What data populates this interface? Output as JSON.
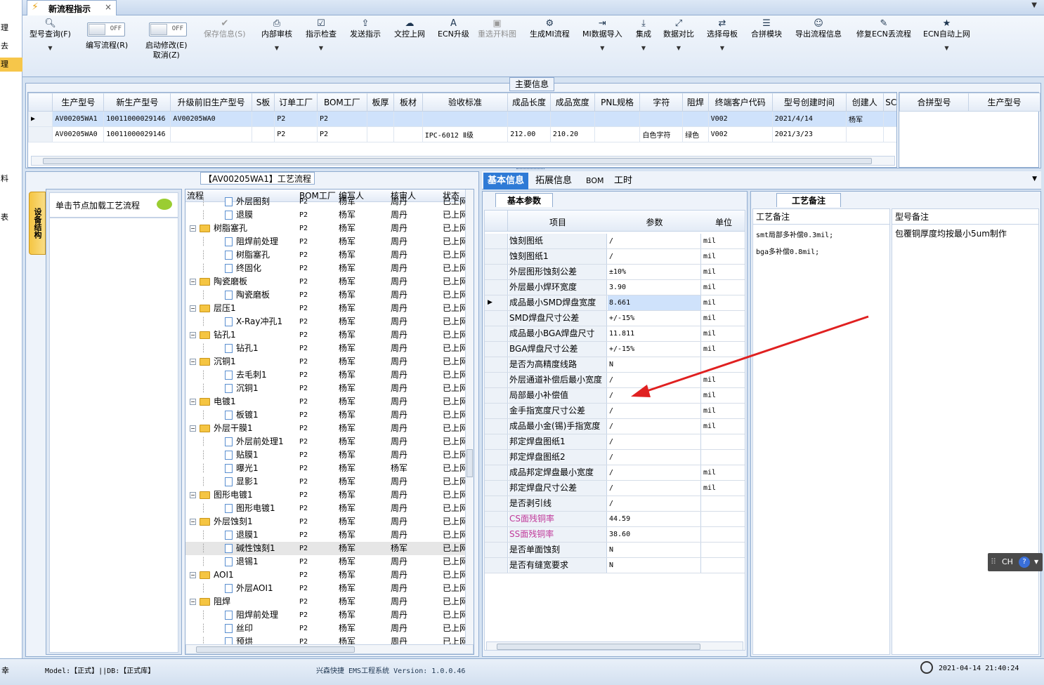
{
  "left_nav": {
    "items": [
      "理",
      "去",
      "理",
      "",
      "",
      "",
      "",
      "",
      "料",
      "",
      "表"
    ]
  },
  "tab": {
    "title": "新流程指示"
  },
  "toolbar": {
    "model_query": "型号查询(F)",
    "edit_flow_toggle": "OFF",
    "edit_flow": "编写流程(R)",
    "enable_modify_toggle": "OFF",
    "enable_modify_1": "启动修改(E)",
    "enable_modify_2": "取消(Z)",
    "save_info": "保存信息(S)",
    "internal_review": "内部审核",
    "instruction_check": "指示检查",
    "send_instruction": "发送指示",
    "doc_control_upload": "文控上网",
    "ecn_upgrade": "ECN升级",
    "reselect_chart": "重选开料图",
    "gen_mi_flow": "生成MI流程",
    "mi_data_import": "MI数据导入",
    "integrate": "集成",
    "data_compare": "数据对比",
    "select_parent": "选择母板",
    "merge_module": "合拼模块",
    "export_flow_info": "导出流程信息",
    "repair_ecn_lost": "修复ECN丢流程",
    "ecn_auto_upload": "ECN自动上网"
  },
  "main_info": {
    "title": "主要信息",
    "columns": [
      "生产型号",
      "新生产型号",
      "升级前旧生产型号",
      "S板",
      "订单工厂",
      "BOM工厂",
      "板厚",
      "板材",
      "验收标准",
      "成品长度",
      "成品宽度",
      "PNL规格",
      "字符",
      "阻焊",
      "终端客户代码",
      "型号创建时间",
      "创建人",
      "SC"
    ],
    "rows": [
      [
        "AV00205WA1",
        "10011000029146",
        "AV00205WA0",
        "",
        "P2",
        "P2",
        "",
        "",
        "",
        "",
        "",
        "",
        "",
        "",
        "V002",
        "2021/4/14",
        "杨军",
        ""
      ],
      [
        "AV00205WA0",
        "10011000029146",
        "",
        "",
        "P2",
        "P2",
        "",
        "",
        "IPC-6012 Ⅱ级",
        "212.00",
        "210.20",
        "",
        "白色字符",
        "绿色",
        "V002",
        "2021/3/23",
        "",
        ""
      ]
    ]
  },
  "merge_panel": {
    "columns": [
      "合拼型号",
      "生产型号"
    ]
  },
  "process_flow": {
    "title": "【AV00205WA1】工艺流程",
    "side_tab": "设备结构",
    "hint": "单击节点加载工艺流程",
    "columns": [
      "流程",
      "BOM工厂",
      "编写人",
      "核审人",
      "状态"
    ],
    "rows": [
      {
        "lvl": 1,
        "name": "外层图刻",
        "bom": "P2",
        "w": "杨军",
        "r": "周丹",
        "s": "已上网"
      },
      {
        "lvl": 1,
        "name": "退膜",
        "bom": "P2",
        "w": "杨军",
        "r": "周丹",
        "s": "已上网"
      },
      {
        "lvl": 0,
        "name": "树脂塞孔",
        "bom": "P2",
        "w": "杨军",
        "r": "周丹",
        "s": "已上网"
      },
      {
        "lvl": 1,
        "name": "阻焊前处理",
        "bom": "P2",
        "w": "杨军",
        "r": "周丹",
        "s": "已上网"
      },
      {
        "lvl": 1,
        "name": "树脂塞孔",
        "bom": "P2",
        "w": "杨军",
        "r": "周丹",
        "s": "已上网"
      },
      {
        "lvl": 1,
        "name": "终固化",
        "bom": "P2",
        "w": "杨军",
        "r": "周丹",
        "s": "已上网"
      },
      {
        "lvl": 0,
        "name": "陶瓷磨板",
        "bom": "P2",
        "w": "杨军",
        "r": "周丹",
        "s": "已上网"
      },
      {
        "lvl": 1,
        "name": "陶瓷磨板",
        "bom": "P2",
        "w": "杨军",
        "r": "周丹",
        "s": "已上网"
      },
      {
        "lvl": 0,
        "name": "层压1",
        "bom": "P2",
        "w": "杨军",
        "r": "周丹",
        "s": "已上网"
      },
      {
        "lvl": 1,
        "name": "X-Ray冲孔1",
        "bom": "P2",
        "w": "杨军",
        "r": "周丹",
        "s": "已上网"
      },
      {
        "lvl": 0,
        "name": "钻孔1",
        "bom": "P2",
        "w": "杨军",
        "r": "周丹",
        "s": "已上网"
      },
      {
        "lvl": 1,
        "name": "钻孔1",
        "bom": "P2",
        "w": "杨军",
        "r": "周丹",
        "s": "已上网"
      },
      {
        "lvl": 0,
        "name": "沉铜1",
        "bom": "P2",
        "w": "杨军",
        "r": "周丹",
        "s": "已上网"
      },
      {
        "lvl": 1,
        "name": "去毛刺1",
        "bom": "P2",
        "w": "杨军",
        "r": "周丹",
        "s": "已上网"
      },
      {
        "lvl": 1,
        "name": "沉铜1",
        "bom": "P2",
        "w": "杨军",
        "r": "周丹",
        "s": "已上网"
      },
      {
        "lvl": 0,
        "name": "电镀1",
        "bom": "P2",
        "w": "杨军",
        "r": "周丹",
        "s": "已上网"
      },
      {
        "lvl": 1,
        "name": "板镀1",
        "bom": "P2",
        "w": "杨军",
        "r": "周丹",
        "s": "已上网"
      },
      {
        "lvl": 0,
        "name": "外层干膜1",
        "bom": "P2",
        "w": "杨军",
        "r": "周丹",
        "s": "已上网"
      },
      {
        "lvl": 1,
        "name": "外层前处理1",
        "bom": "P2",
        "w": "杨军",
        "r": "周丹",
        "s": "已上网"
      },
      {
        "lvl": 1,
        "name": "贴膜1",
        "bom": "P2",
        "w": "杨军",
        "r": "周丹",
        "s": "已上网"
      },
      {
        "lvl": 1,
        "name": "曝光1",
        "bom": "P2",
        "w": "杨军",
        "r": "杨军",
        "s": "已上网"
      },
      {
        "lvl": 1,
        "name": "显影1",
        "bom": "P2",
        "w": "杨军",
        "r": "周丹",
        "s": "已上网"
      },
      {
        "lvl": 0,
        "name": "图形电镀1",
        "bom": "P2",
        "w": "杨军",
        "r": "周丹",
        "s": "已上网"
      },
      {
        "lvl": 1,
        "name": "图形电镀1",
        "bom": "P2",
        "w": "杨军",
        "r": "周丹",
        "s": "已上网"
      },
      {
        "lvl": 0,
        "name": "外层蚀刻1",
        "bom": "P2",
        "w": "杨军",
        "r": "周丹",
        "s": "已上网"
      },
      {
        "lvl": 1,
        "name": "退膜1",
        "bom": "P2",
        "w": "杨军",
        "r": "周丹",
        "s": "已上网"
      },
      {
        "lvl": 1,
        "name": "碱性蚀刻1",
        "bom": "P2",
        "w": "杨军",
        "r": "杨军",
        "s": "已上网",
        "sel": true
      },
      {
        "lvl": 1,
        "name": "退锡1",
        "bom": "P2",
        "w": "杨军",
        "r": "周丹",
        "s": "已上网"
      },
      {
        "lvl": 0,
        "name": "AOI1",
        "bom": "P2",
        "w": "杨军",
        "r": "周丹",
        "s": "已上网"
      },
      {
        "lvl": 1,
        "name": "外层AOI1",
        "bom": "P2",
        "w": "杨军",
        "r": "周丹",
        "s": "已上网"
      },
      {
        "lvl": 0,
        "name": "阻焊",
        "bom": "P2",
        "w": "杨军",
        "r": "周丹",
        "s": "已上网"
      },
      {
        "lvl": 1,
        "name": "阻焊前处理",
        "bom": "P2",
        "w": "杨军",
        "r": "周丹",
        "s": "已上网"
      },
      {
        "lvl": 1,
        "name": "丝印",
        "bom": "P2",
        "w": "杨军",
        "r": "周丹",
        "s": "已上网"
      },
      {
        "lvl": 1,
        "name": "预烘",
        "bom": "P2",
        "w": "杨军",
        "r": "周丹",
        "s": "已上网"
      }
    ]
  },
  "detail_tabs": [
    "基本信息",
    "拓展信息",
    "BOM",
    "工时"
  ],
  "basic_params": {
    "title": "基本参数",
    "columns": [
      "项目",
      "参数",
      "单位"
    ],
    "rows": [
      {
        "item": "蚀刻图纸",
        "value": "/",
        "unit": "mil"
      },
      {
        "item": "蚀刻图纸1",
        "value": "/",
        "unit": "mil"
      },
      {
        "item": "外层图形蚀刻公差",
        "value": "±10%",
        "unit": "mil"
      },
      {
        "item": "外层最小焊环宽度",
        "value": "3.90",
        "unit": "mil"
      },
      {
        "item": "成品最小SMD焊盘宽度",
        "value": "8.661",
        "unit": "mil",
        "sel": true
      },
      {
        "item": "SMD焊盘尺寸公差",
        "value": "+/-15%",
        "unit": "mil"
      },
      {
        "item": "成品最小BGA焊盘尺寸",
        "value": "11.811",
        "unit": "mil"
      },
      {
        "item": "BGA焊盘尺寸公差",
        "value": "+/-15%",
        "unit": "mil"
      },
      {
        "item": "是否为高精度线路",
        "value": "N",
        "unit": ""
      },
      {
        "item": "外层通道补偿后最小宽度",
        "value": "/",
        "unit": "mil"
      },
      {
        "item": "局部最小补偿值",
        "value": "/",
        "unit": "mil"
      },
      {
        "item": "金手指宽度尺寸公差",
        "value": "/",
        "unit": "mil"
      },
      {
        "item": "成品最小金(锡)手指宽度",
        "value": "/",
        "unit": "mil"
      },
      {
        "item": "邦定焊盘图纸1",
        "value": "/",
        "unit": ""
      },
      {
        "item": "邦定焊盘图纸2",
        "value": "/",
        "unit": ""
      },
      {
        "item": "成品邦定焊盘最小宽度",
        "value": "/",
        "unit": "mil"
      },
      {
        "item": "邦定焊盘尺寸公差",
        "value": "/",
        "unit": "mil"
      },
      {
        "item": "是否剥引线",
        "value": "/",
        "unit": ""
      },
      {
        "item": "CS面残铜率",
        "value": "44.59",
        "unit": "",
        "pink": true
      },
      {
        "item": "SS面残铜率",
        "value": "38.60",
        "unit": "",
        "pink": true
      },
      {
        "item": "是否单面蚀刻",
        "value": "N",
        "unit": ""
      },
      {
        "item": "是否有缝宽要求",
        "value": "N",
        "unit": ""
      }
    ]
  },
  "remarks": {
    "tab": "工艺备注",
    "columns": [
      "工艺备注",
      "型号备注"
    ],
    "process_lines": [
      "smt局部多补偿0.3mil;",
      "bga多补偿0.8mil;"
    ],
    "model_line": "包覆铜厚度均按最小5um制作"
  },
  "ime": {
    "label": "CH"
  },
  "status": {
    "left": "幸",
    "model_db": "Model:【正式】||DB:【正式库】",
    "system": "兴森快捷 EMS工程系统 Version: 1.0.0.46",
    "datetime": "2021-04-14 21:40:24"
  },
  "colors": {
    "accent": "#2e7ad6",
    "pink_label": "#c0399a",
    "arrow": "#e02020",
    "selection": "#cfe2fb"
  }
}
